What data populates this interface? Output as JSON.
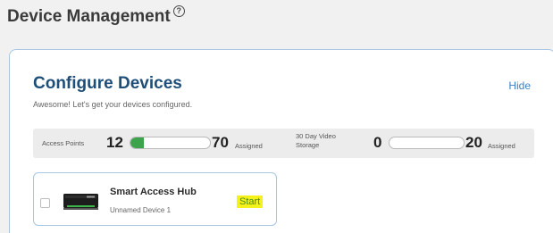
{
  "page": {
    "title": "Device Management",
    "help_icon": "question-circle-icon"
  },
  "configure": {
    "title": "Configure Devices",
    "hide_label": "Hide",
    "subtitle": "Awesome! Let's get your devices configured."
  },
  "stats": {
    "access_points": {
      "label": "Access Points",
      "count": "12",
      "total": "70",
      "assigned_label": "Assigned",
      "progress_fraction": 0.17
    },
    "video_storage": {
      "label_line1": "30 Day Video",
      "label_line2": "Storage",
      "count": "0",
      "total": "20",
      "assigned_label": "Assigned",
      "progress_fraction": 0
    }
  },
  "devices": [
    {
      "name": "Smart Access Hub",
      "subtitle": "Unnamed Device 1",
      "action_label": "Start",
      "icon": "access-hub-device-icon"
    }
  ],
  "colors": {
    "title_blue": "#1f4e79",
    "link_blue": "#3e7fc4",
    "progress_green": "#3ca34c",
    "card_border": "#a7c6e3",
    "highlight_yellow": "#f4f21a"
  }
}
